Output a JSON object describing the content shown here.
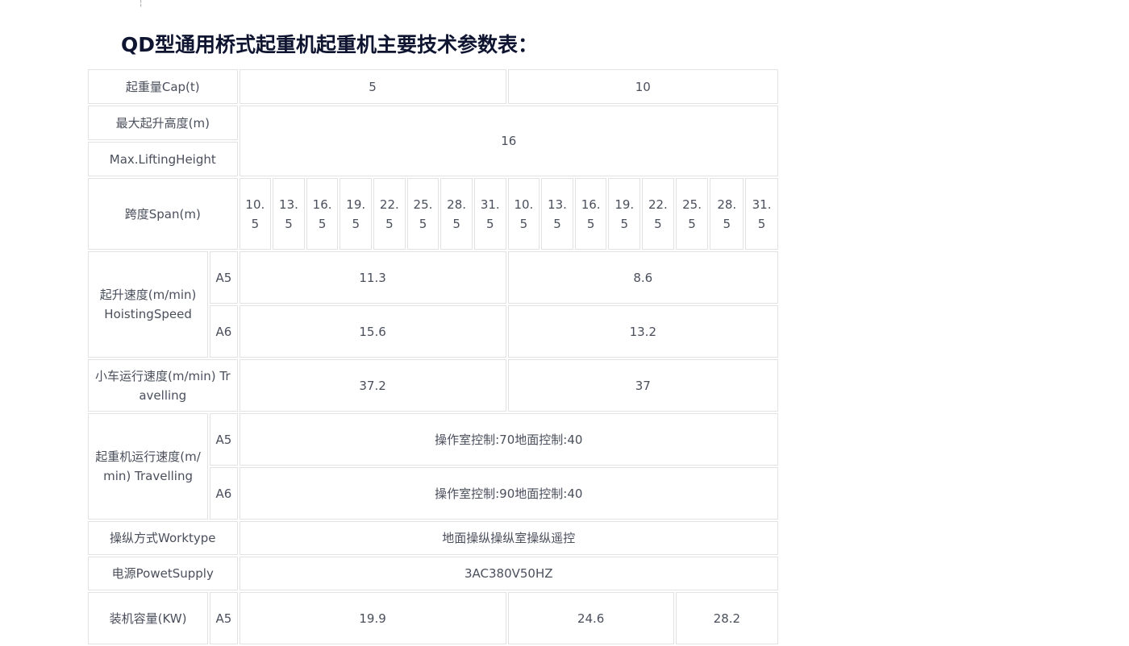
{
  "title": "QD型通用桥式起重机起重机主要技术参数表：",
  "caret": "¦",
  "rows": {
    "capacity": {
      "label": "起重量Cap(t)",
      "values": [
        "5",
        "10"
      ]
    },
    "lifting_height": {
      "label_cn": "最大起升高度(m)",
      "label_en": "Max.LiftingHeight",
      "value": "16"
    },
    "span": {
      "label": "跨度Span(m)",
      "values": [
        "10.5",
        "13.5",
        "16.5",
        "19.5",
        "22.5",
        "25.5",
        "28.5",
        "31.5",
        "10.5",
        "13.5",
        "16.5",
        "19.5",
        "22.5",
        "25.5",
        "28.5",
        "31.5"
      ]
    },
    "hoisting_speed": {
      "label": "起升速度(m/min) HoistingSpeed",
      "a5": {
        "sub": "A5",
        "values": [
          "11.3",
          "8.6"
        ]
      },
      "a6": {
        "sub": "A6",
        "values": [
          "15.6",
          "13.2"
        ]
      }
    },
    "trolley_speed": {
      "label": "小车运行速度(m/min) Travelling",
      "values": [
        "37.2",
        "37"
      ]
    },
    "crane_speed": {
      "label": "起重机运行速度(m/min) Travelling",
      "a5": {
        "sub": "A5",
        "value": "操作室控制:70地面控制:40"
      },
      "a6": {
        "sub": "A6",
        "value": "操作室控制:90地面控制:40"
      }
    },
    "worktype": {
      "label": "操纵方式Worktype",
      "value": "地面操纵操纵室操纵遥控"
    },
    "power_supply": {
      "label": "电源PowetSupply",
      "value": "3AC380V50HZ"
    },
    "installed_capacity": {
      "label": "装机容量(KW)",
      "sub": "A5",
      "values": [
        "19.9",
        "24.6",
        "28.2"
      ]
    }
  }
}
